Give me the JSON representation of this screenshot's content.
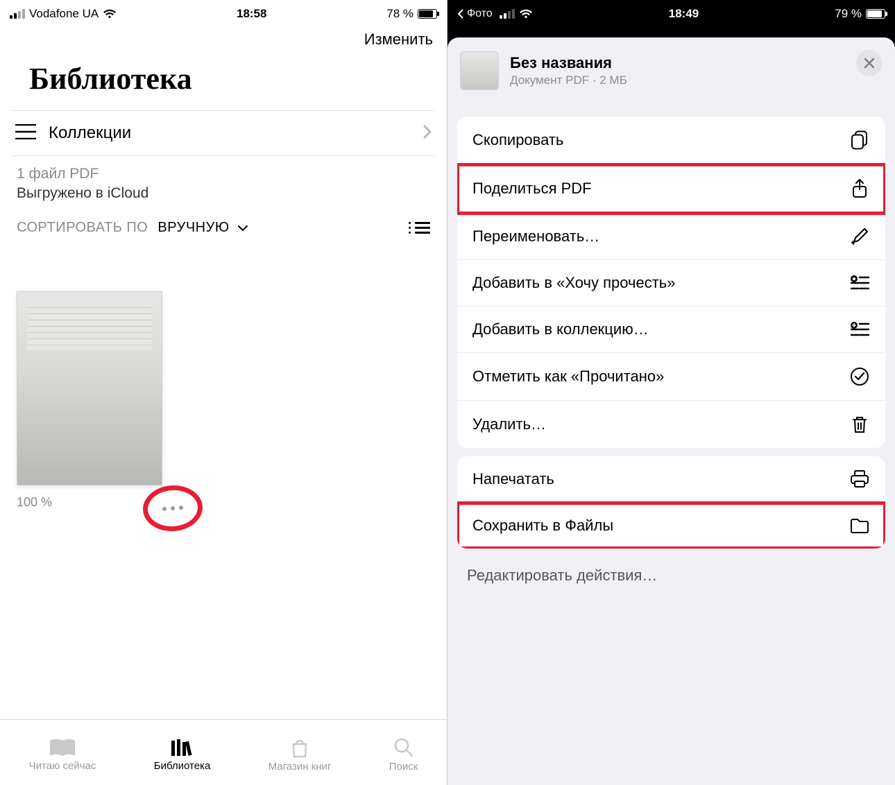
{
  "left": {
    "status": {
      "carrier": "Vodafone UA",
      "time": "18:58",
      "battery_pct": "78 %"
    },
    "edit": "Изменить",
    "title": "Библиотека",
    "collections": "Коллекции",
    "file_count": "1 файл PDF",
    "sync_status": "Выгружено в iCloud",
    "sort_label": "СОРТИРОВАТЬ ПО",
    "sort_value": "ВРУЧНУЮ",
    "doc_progress": "100 %",
    "tabs": {
      "reading": "Читаю сейчас",
      "library": "Библиотека",
      "store": "Магазин книг",
      "search": "Поиск"
    }
  },
  "right": {
    "status": {
      "back_app": "Фото",
      "time": "18:49",
      "battery_pct": "79 %"
    },
    "doc": {
      "title": "Без названия",
      "meta": "Документ PDF · 2 МБ"
    },
    "actions": {
      "copy": "Скопировать",
      "share": "Поделиться PDF",
      "rename": "Переименовать…",
      "want": "Добавить в «Хочу прочесть»",
      "collection": "Добавить в коллекцию…",
      "mark_read": "Отметить как «Прочитано»",
      "delete": "Удалить…",
      "print": "Напечатать",
      "save_files": "Сохранить в Файлы",
      "edit_actions": "Редактировать действия…"
    }
  }
}
